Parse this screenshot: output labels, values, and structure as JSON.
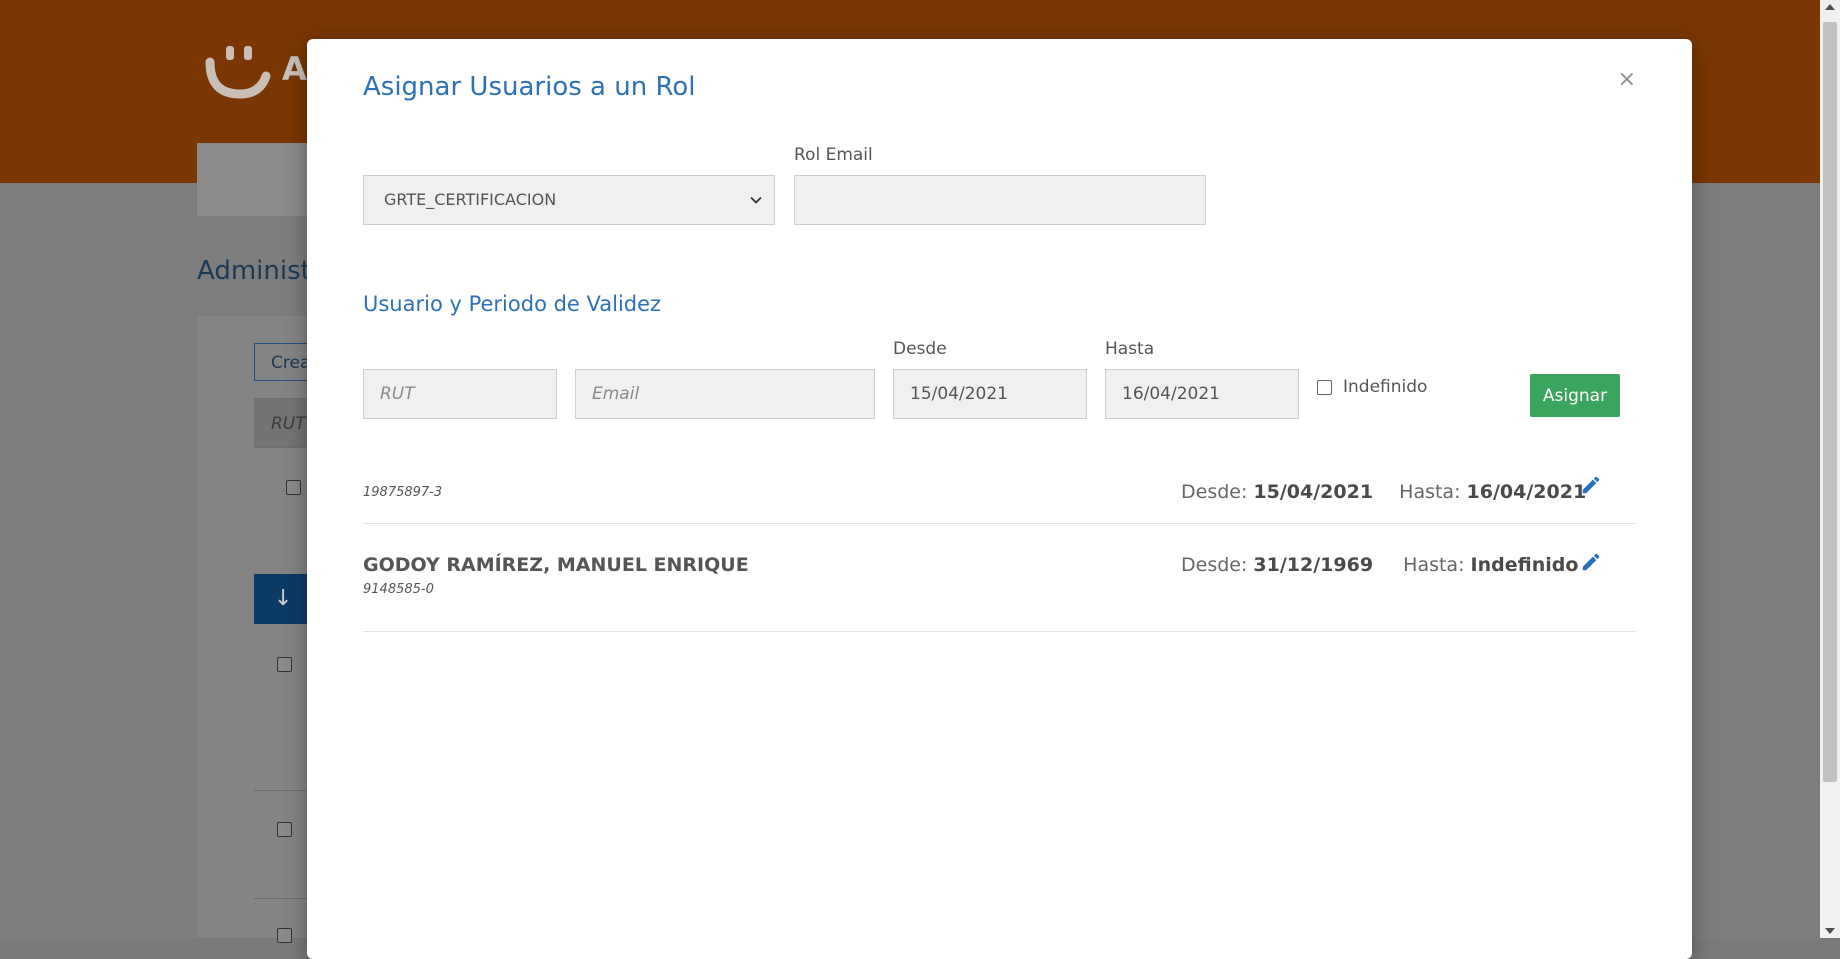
{
  "background": {
    "logo_letter": "A",
    "page_title": "Administr",
    "create_button": "Crea",
    "rut_placeholder": "RUT"
  },
  "modal": {
    "title": "Asignar Usuarios a un Rol",
    "close_label": "×",
    "role_select": {
      "selected": "GRTE_CERTIFICACION"
    },
    "rol_email": {
      "label": "Rol Email",
      "value": ""
    },
    "section_title": "Usuario y Periodo de Validez",
    "form": {
      "rut_placeholder": "RUT",
      "email_placeholder": "Email",
      "desde_label": "Desde",
      "desde_value": "15/04/2021",
      "hasta_label": "Hasta",
      "hasta_value": "16/04/2021",
      "indefinido_label": "Indefinido",
      "indefinido_checked": false,
      "assign_label": "Asignar"
    },
    "users": [
      {
        "name": "",
        "rut": "19875897-3",
        "desde_label": "Desde:",
        "desde": "15/04/2021",
        "hasta_label": "Hasta:",
        "hasta": "16/04/2021"
      },
      {
        "name": "GODOY RAMÍREZ, MANUEL ENRIQUE",
        "rut": "9148585-0",
        "desde_label": "Desde:",
        "desde": "31/12/1969",
        "hasta_label": "Hasta:",
        "hasta": "Indefinido"
      }
    ]
  },
  "colors": {
    "header_bg": "#7a3703",
    "accent_blue": "#2d72b8",
    "assign_green": "#3aa55e",
    "edit_icon_blue": "#2570bf"
  },
  "icons": {
    "close": "close-icon",
    "chevron": "chevron-down-icon",
    "edit": "pencil-icon",
    "download": "download-icon"
  }
}
